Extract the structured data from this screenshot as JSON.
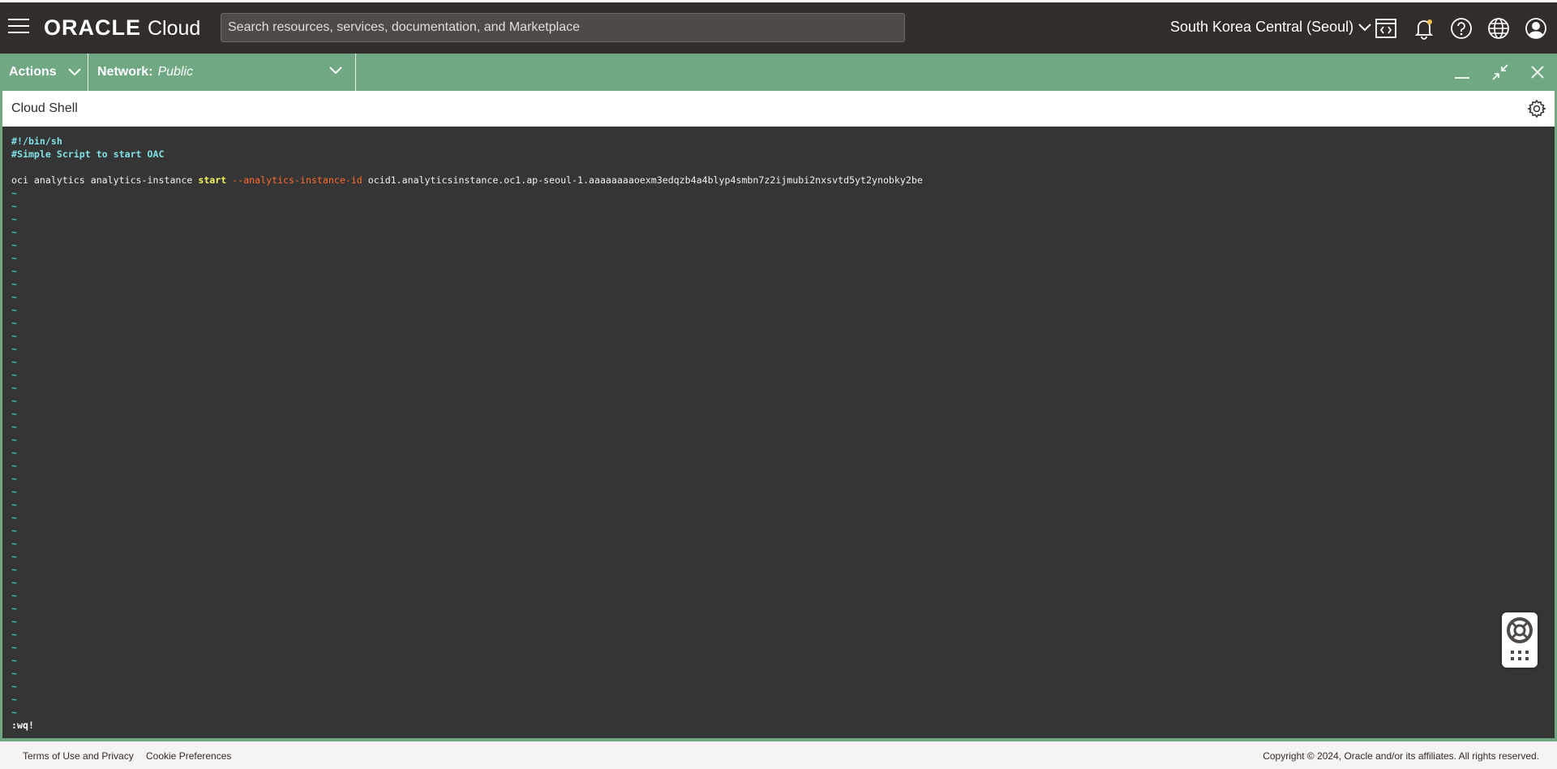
{
  "topnav": {
    "brand": "ORACLE",
    "product": "Cloud",
    "search_placeholder": "Search resources, services, documentation, and Marketplace",
    "region": "South Korea Central (Seoul)"
  },
  "shellbar": {
    "actions_label": "Actions",
    "network_label": "Network:",
    "network_value": "Public"
  },
  "shell": {
    "title": "Cloud Shell",
    "lines": {
      "shebang": "#!/bin/sh",
      "comment": "#Simple Script to start OAC",
      "cmd_prefix": "oci analytics analytics-instance ",
      "cmd_start": "start",
      "cmd_option": "--analytics-instance-id",
      "cmd_value": " ocid1.analyticsinstance.oc1.ap-seoul-1.aaaaaaaaoexm3edqzb4a4blyp4smbn7z2ijmubi2nxsvtd5yt2ynobky2be"
    },
    "tilde": "~",
    "tilde_count": 41,
    "command_line": ":wq!"
  },
  "footer": {
    "terms": "Terms of Use and Privacy",
    "cookies": "Cookie Preferences",
    "copyright": "Copyright © 2024, Oracle and/or its affiliates. All rights reserved."
  },
  "colors": {
    "nav_bg": "#312d2a",
    "shell_accent": "#6fa883",
    "terminal_bg": "#353535"
  }
}
